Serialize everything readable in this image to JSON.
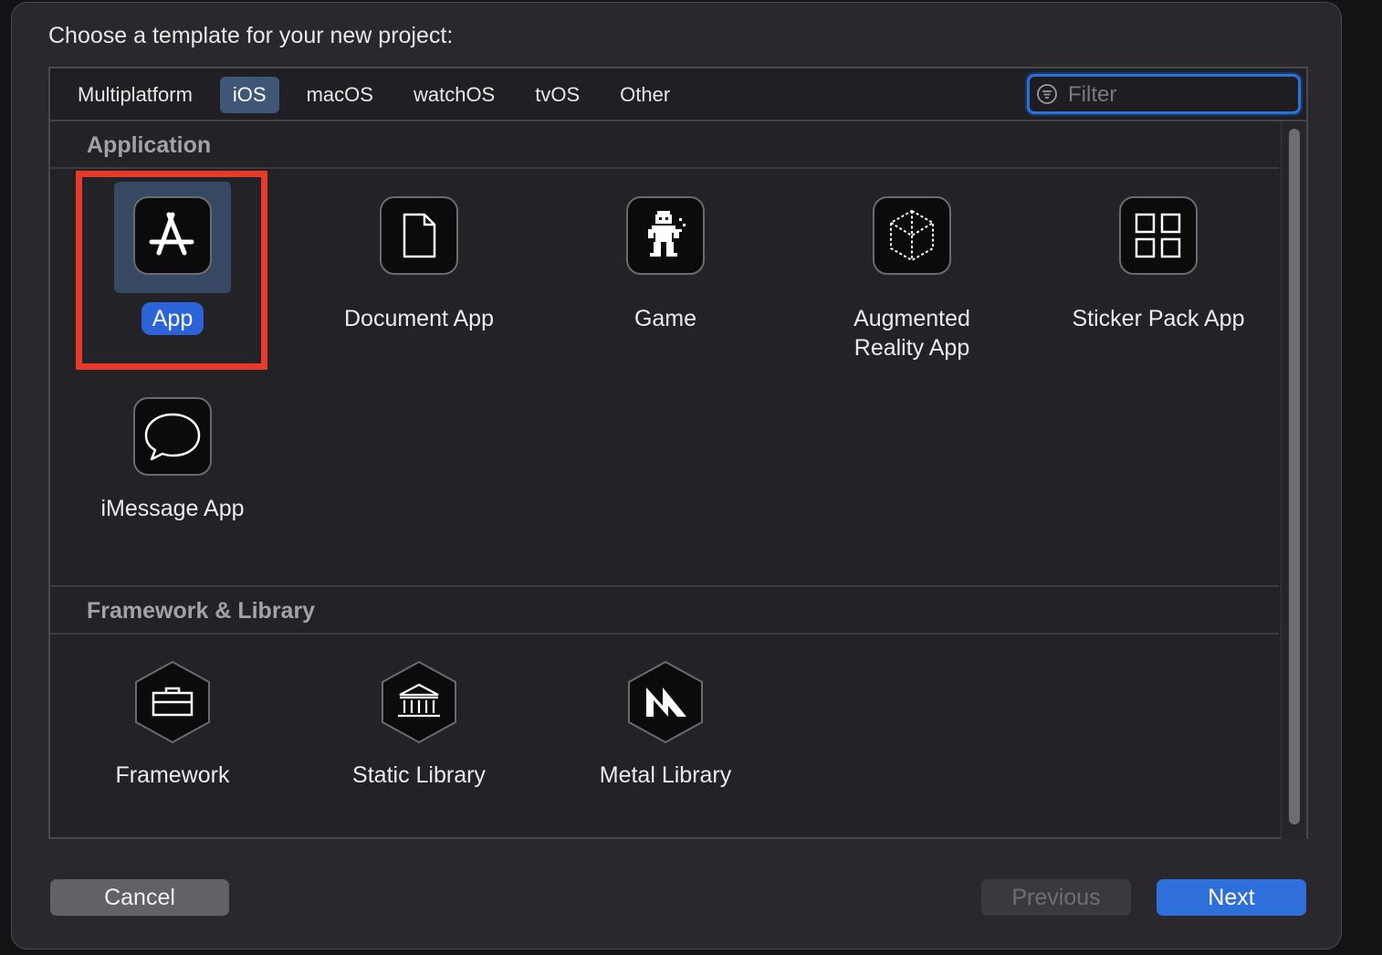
{
  "dialog": {
    "title": "Choose a template for your new project:"
  },
  "tabs": [
    {
      "label": "Multiplatform",
      "selected": false
    },
    {
      "label": "iOS",
      "selected": true
    },
    {
      "label": "macOS",
      "selected": false
    },
    {
      "label": "watchOS",
      "selected": false
    },
    {
      "label": "tvOS",
      "selected": false
    },
    {
      "label": "Other",
      "selected": false
    }
  ],
  "filter": {
    "placeholder": "Filter",
    "value": "",
    "icon": "filter-icon"
  },
  "sections": {
    "application": {
      "title": "Application",
      "templates": [
        {
          "label": "App",
          "icon": "app-store-icon",
          "selected": true
        },
        {
          "label": "Document App",
          "icon": "document-icon",
          "selected": false
        },
        {
          "label": "Game",
          "icon": "game-sprite-icon",
          "selected": false
        },
        {
          "label": "Augmented Reality App",
          "icon": "ar-cube-icon",
          "selected": false
        },
        {
          "label": "Sticker Pack App",
          "icon": "sticker-grid-icon",
          "selected": false
        },
        {
          "label": "iMessage App",
          "icon": "speech-bubble-icon",
          "selected": false
        }
      ]
    },
    "framework": {
      "title": "Framework & Library",
      "templates": [
        {
          "label": "Framework",
          "icon": "toolbox-icon"
        },
        {
          "label": "Static Library",
          "icon": "bank-building-icon"
        },
        {
          "label": "Metal Library",
          "icon": "metal-logo-icon"
        }
      ]
    }
  },
  "buttons": {
    "cancel": "Cancel",
    "previous": "Previous",
    "next": "Next"
  },
  "colors": {
    "accent": "#2f6fdb",
    "highlight": "#e8392a",
    "dialog_bg": "#2a282d"
  }
}
